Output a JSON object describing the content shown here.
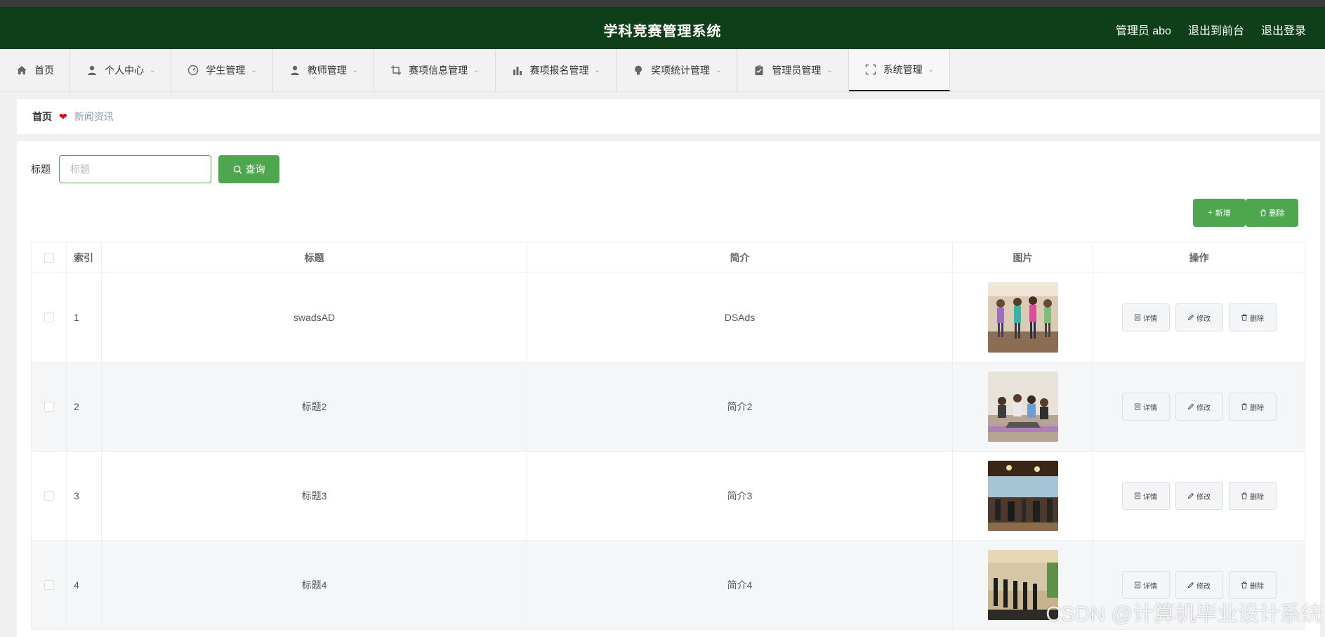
{
  "header": {
    "title": "学科竞赛管理系统",
    "user": "管理员 abo",
    "to_front": "退出到前台",
    "logout": "退出登录"
  },
  "nav": [
    {
      "label": "首页",
      "icon": "home-icon"
    },
    {
      "label": "个人中心",
      "icon": "user-icon"
    },
    {
      "label": "学生管理",
      "icon": "dashboard-icon"
    },
    {
      "label": "教师管理",
      "icon": "person-icon"
    },
    {
      "label": "赛项信息管理",
      "icon": "crop-icon"
    },
    {
      "label": "赛项报名管理",
      "icon": "bar-chart-icon"
    },
    {
      "label": "奖项统计管理",
      "icon": "bulb-icon"
    },
    {
      "label": "管理员管理",
      "icon": "clipboard-icon"
    },
    {
      "label": "系统管理",
      "icon": "fullscreen-icon"
    }
  ],
  "breadcrumb": {
    "home": "首页",
    "current": "新闻资讯"
  },
  "search": {
    "label": "标题",
    "placeholder": "标题",
    "value": "",
    "button": "查询"
  },
  "actions": {
    "add": "新增",
    "delete": "删除"
  },
  "table": {
    "columns": [
      "索引",
      "标题",
      "简介",
      "图片",
      "操作"
    ],
    "rows": [
      {
        "index": "1",
        "title": "swadsAD",
        "intro": "DSAds",
        "image": "yoga-class-photo"
      },
      {
        "index": "2",
        "title": "标题2",
        "intro": "简介2",
        "image": "yoga-group-photo"
      },
      {
        "index": "3",
        "title": "标题3",
        "intro": "简介3",
        "image": "gym-interior-photo"
      },
      {
        "index": "4",
        "title": "标题4",
        "intro": "简介4",
        "image": "treadmill-row-photo"
      }
    ],
    "row_actions": {
      "detail": "详情",
      "edit": "修改",
      "delete": "删除"
    }
  },
  "watermark": "CSDN @计算机毕业设计系统",
  "colors": {
    "header_bg": "#0f3f18",
    "accent": "#4ea64f",
    "heart": "#e60012"
  }
}
